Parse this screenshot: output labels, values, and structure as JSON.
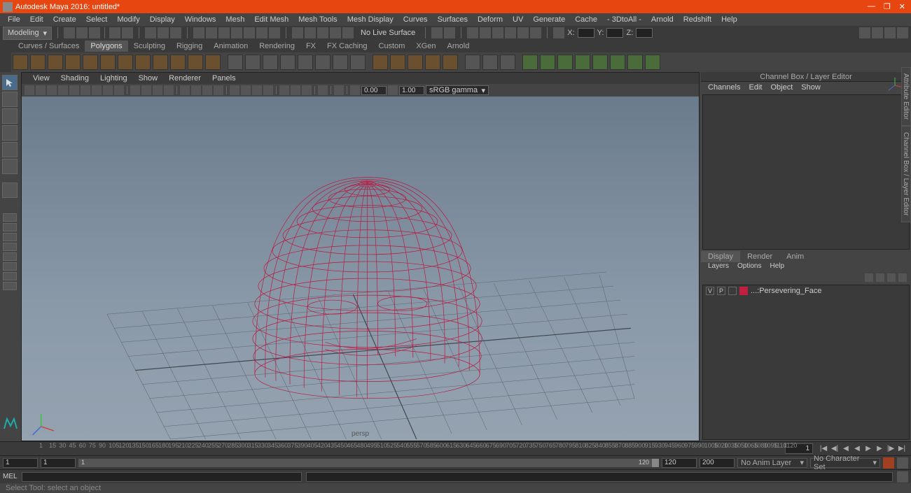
{
  "window": {
    "title": "Autodesk Maya 2016: untitled*",
    "minimize": "—",
    "maximize": "❐",
    "close": "✕"
  },
  "menubar": [
    "File",
    "Edit",
    "Create",
    "Select",
    "Modify",
    "Display",
    "Windows",
    "Mesh",
    "Edit Mesh",
    "Mesh Tools",
    "Mesh Display",
    "Curves",
    "Surfaces",
    "Deform",
    "UV",
    "Generate",
    "Cache",
    "- 3DtoAll -",
    "Arnold",
    "Redshift",
    "Help"
  ],
  "mode": "Modeling",
  "no_live_surface": "No Live Surface",
  "coords": {
    "x_label": "X:",
    "y_label": "Y:",
    "z_label": "Z:",
    "x": "",
    "y": "",
    "z": ""
  },
  "shelf_tabs": [
    "Curves / Surfaces",
    "Polygons",
    "Sculpting",
    "Rigging",
    "Animation",
    "Rendering",
    "FX",
    "FX Caching",
    "Custom",
    "XGen",
    "Arnold"
  ],
  "active_shelf_tab": "Polygons",
  "panel_menu": [
    "View",
    "Shading",
    "Lighting",
    "Show",
    "Renderer",
    "Panels"
  ],
  "panel_toolbar": {
    "exposure": "0.00",
    "gamma": "1.00",
    "colorspace": "sRGB gamma"
  },
  "viewport": {
    "camera": "persp"
  },
  "channel_box": {
    "title": "Channel Box / Layer Editor",
    "menus": [
      "Channels",
      "Edit",
      "Object",
      "Show"
    ]
  },
  "side_tabs": [
    "Attribute Editor",
    "Channel Box / Layer Editor"
  ],
  "layer_panel": {
    "tabs": [
      "Display",
      "Render",
      "Anim"
    ],
    "active_tab": "Display",
    "menus": [
      "Layers",
      "Options",
      "Help"
    ],
    "layers": [
      {
        "v": "V",
        "p": "P",
        "color": "#c02040",
        "name": "...:Persevering_Face"
      }
    ]
  },
  "timeslider": {
    "ticks": [
      "1",
      "15",
      "30",
      "45",
      "60",
      "75",
      "90",
      "105",
      "120",
      "135",
      "150",
      "165",
      "180",
      "195",
      "210",
      "225",
      "240",
      "255",
      "270",
      "285",
      "300",
      "315",
      "330",
      "345",
      "360",
      "375",
      "390",
      "405",
      "420",
      "435",
      "450",
      "465",
      "480",
      "495",
      "510",
      "525",
      "540",
      "555",
      "570",
      "585",
      "600",
      "615",
      "630",
      "645",
      "660",
      "675",
      "690",
      "705",
      "720",
      "735",
      "750",
      "765",
      "780",
      "795",
      "810",
      "825",
      "840",
      "855",
      "870",
      "885",
      "900",
      "915",
      "930",
      "945",
      "960",
      "975",
      "990",
      "1005",
      "1020",
      "1035",
      "1050",
      "1065",
      "1080",
      "1095",
      "1110",
      "1120"
    ],
    "current_frame": "1"
  },
  "range": {
    "start": "1",
    "inner_start": "1",
    "inner_end": "120",
    "end_a": "120",
    "end_b": "200",
    "anim_layer": "No Anim Layer",
    "char_set": "No Character Set"
  },
  "cmdline": {
    "lang": "MEL"
  },
  "helpline": "Select Tool: select an object"
}
